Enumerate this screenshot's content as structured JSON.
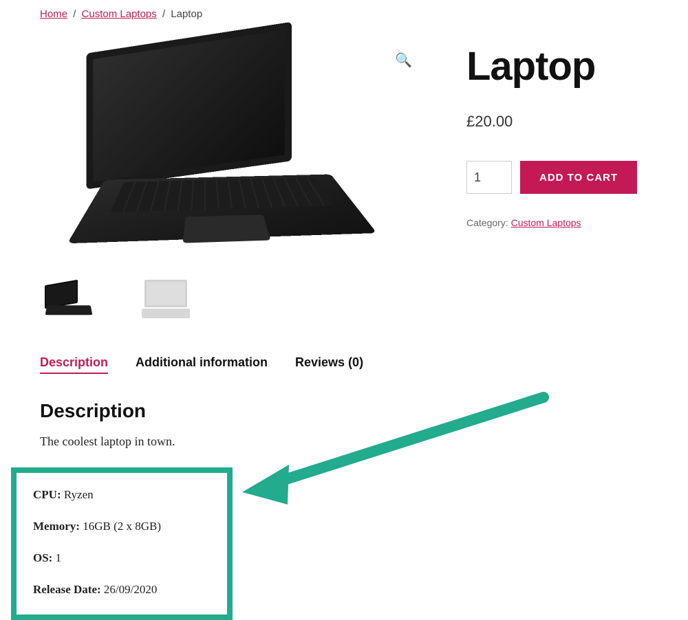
{
  "breadcrumb": {
    "home": "Home",
    "category": "Custom Laptops",
    "current": "Laptop"
  },
  "product": {
    "title": "Laptop",
    "price": "£20.00",
    "qty_value": "1",
    "add_to_cart": "ADD TO CART",
    "category_label": "Category:",
    "category_link": "Custom Laptops"
  },
  "tabs": {
    "description": "Description",
    "additional": "Additional information",
    "reviews": "Reviews (0)"
  },
  "description": {
    "heading": "Description",
    "tagline": "The coolest laptop in town."
  },
  "specs": {
    "cpu_label": "CPU:",
    "cpu_value": "Ryzen",
    "memory_label": "Memory:",
    "memory_value": "16GB (2 x 8GB)",
    "os_label": "OS:",
    "os_value": "1",
    "release_label": "Release Date:",
    "release_value": "26/09/2020"
  },
  "icons": {
    "zoom": "🔍"
  }
}
